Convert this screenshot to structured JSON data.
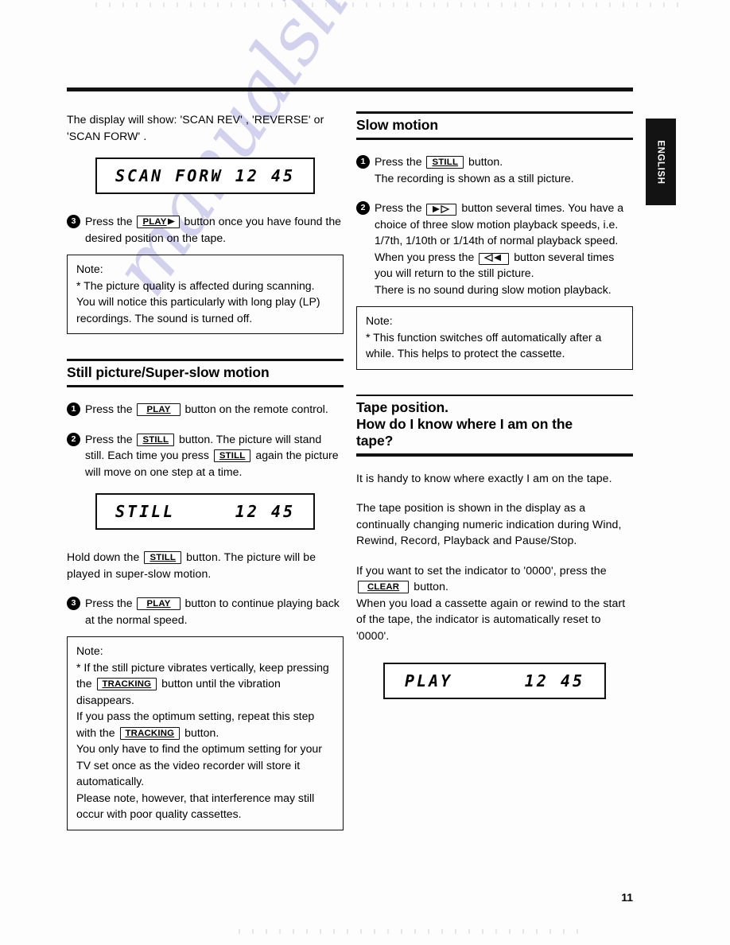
{
  "page": {
    "number": "11",
    "language_tab": "ENGLISH",
    "watermark": "manualslive.com"
  },
  "left_column": {
    "intro": "The display will show: 'SCAN REV' , 'REVERSE' or 'SCAN FORW' .",
    "display_scan": {
      "mode": "SCAN FORW",
      "counter": "12 45"
    },
    "step3": {
      "number": "3",
      "text_before": "Press the",
      "key": "PLAY",
      "key_icon": "play-triangle-icon",
      "text_after": "button once you have found the desired position on the tape."
    },
    "note_scan": {
      "title": "Note:",
      "text": "* The picture quality is affected during scanning. You will notice this particularly with long play (LP) recordings. The sound is turned off."
    },
    "section_still": {
      "title": "Still picture/Super-slow motion",
      "step1": {
        "number": "1",
        "text_before": "Press the",
        "key": "PLAY",
        "text_after": "button on the remote control."
      },
      "step2": {
        "number": "2",
        "text_before": "Press the",
        "key": "STILL",
        "text_after": "button. The picture will stand still.",
        "line2_before": "Each time you press",
        "line2_key": "STILL",
        "line2_after": "again the picture will move on one step at a time."
      },
      "display_still": {
        "mode": "STILL",
        "counter": "12 45"
      },
      "hold_text_before": "Hold down the",
      "hold_key": "STILL",
      "hold_text_after": "button. The picture will be played in super-slow motion.",
      "step3": {
        "number": "3",
        "text_before": "Press the",
        "key": "PLAY",
        "text_after": "button to continue playing back at the normal speed."
      },
      "note": {
        "title": "Note:",
        "line1_before": "* If the still picture vibrates vertically, keep pressing the",
        "line1_key": "TRACKING",
        "line1_icon": "tracking-down-icon",
        "line1_after": "button until the vibration disappears.",
        "line2_before": "If you pass the optimum setting, repeat this step with the",
        "line2_key": "TRACKING",
        "line2_icon": "tracking-up-icon",
        "line2_after": "button.",
        "line3": "You only have to find the optimum setting for your TV set once as the video recorder will store it automatically.",
        "line4": "Please note, however, that interference may still occur with poor quality cassettes."
      }
    }
  },
  "right_column": {
    "section_slow": {
      "title": "Slow motion",
      "step1": {
        "number": "1",
        "text_before": "Press the",
        "key": "STILL",
        "text_after": "button.",
        "line2": "The recording is shown as a still picture."
      },
      "step2": {
        "number": "2",
        "text_before": "Press the",
        "key_icon": "slow-forward-icon",
        "text_mid": "button several times. You have a choice of three slow motion playback speeds, i.e. 1/7th, 1/10th or 1/14th of normal playback speed. When you press the",
        "key_icon2": "slow-reverse-icon",
        "text_after": "button several times you will return to the still picture.",
        "line_last": "There is no sound during slow motion playback."
      },
      "note": {
        "title": "Note:",
        "text": "* This function switches off automatically after a while. This helps to protect the cassette."
      }
    },
    "section_tape": {
      "title_line1": "Tape position.",
      "title_line2": "How do I know where I am on the",
      "title_line3": "tape?",
      "para1": "It is handy to know where exactly I am on the tape.",
      "para2": "The tape position is shown in the display as a continually changing numeric indication during Wind, Rewind, Record, Playback and Pause/Stop.",
      "para3_before": "If you want to set the indicator to '0000', press the",
      "para3_key": "CLEAR",
      "para3_after": "button.",
      "para4": "When you load a cassette again or rewind to the start of the tape, the indicator is automatically reset to '0000'.",
      "display_play": {
        "mode": "PLAY",
        "counter": "12 45"
      }
    }
  }
}
